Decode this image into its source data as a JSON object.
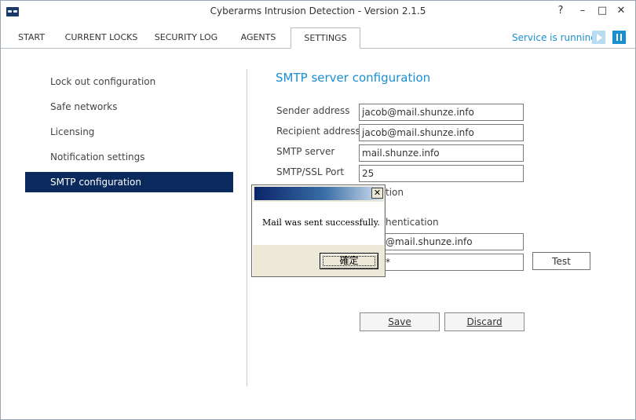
{
  "window": {
    "title": "Cyberarms Intrusion Detection - Version 2.1.5",
    "help_glyph": "?",
    "minimize_glyph": "–",
    "maximize_glyph": "□",
    "close_glyph": "✕"
  },
  "tabs": [
    {
      "label": "START",
      "active": false
    },
    {
      "label": "CURRENT LOCKS",
      "active": false
    },
    {
      "label": "SECURITY LOG",
      "active": false
    },
    {
      "label": "AGENTS",
      "active": false
    },
    {
      "label": "SETTINGS",
      "active": true
    }
  ],
  "service": {
    "status": "Service is running",
    "status_color": "#1a8fd0"
  },
  "sidebar": {
    "items": [
      {
        "label": "Lock out configuration",
        "active": false
      },
      {
        "label": "Safe networks",
        "active": false
      },
      {
        "label": "Licensing",
        "active": false
      },
      {
        "label": "Notification settings",
        "active": false
      },
      {
        "label": "SMTP configuration",
        "active": true
      }
    ],
    "active_color": "#0a2a5e"
  },
  "smtp": {
    "title": "SMTP server configuration",
    "sender_label": "Sender address",
    "sender_value": "jacob@mail.shunze.info",
    "recipient_label": "Recipient address",
    "recipient_value": "jacob@mail.shunze.info",
    "server_label": "SMTP server",
    "server_value": "mail.shunze.info",
    "port_label": "SMTP/SSL Port",
    "port_value": "25",
    "ssl_partial": "tion",
    "auth_partial": "hentication",
    "username_partial": "@mail.shunze.info",
    "password_partial": "*",
    "test_label": "Test",
    "save_label": "Save",
    "discard_label": "Discard"
  },
  "dialog": {
    "message": "Mail was sent successfully.",
    "ok_label": "確定",
    "close_glyph": "✕"
  }
}
